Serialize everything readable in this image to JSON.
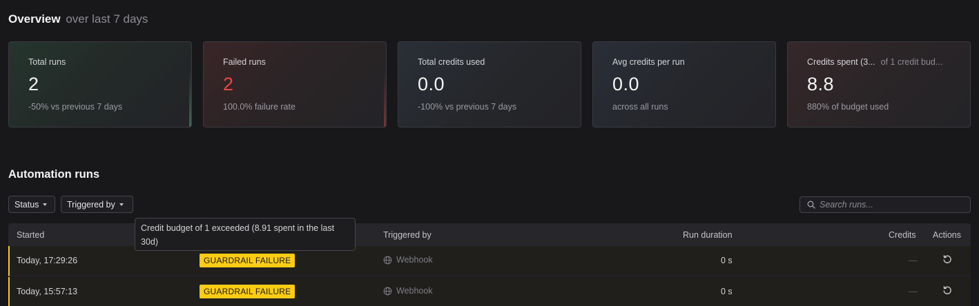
{
  "overview": {
    "title": "Overview",
    "subtitle": "over last 7 days"
  },
  "cards": [
    {
      "label": "Total runs",
      "value": "2",
      "note": "-50% vs previous 7 days"
    },
    {
      "label": "Failed runs",
      "value": "2",
      "note": "100.0% failure rate",
      "value_color": "#ef4444"
    },
    {
      "label": "Total credits used",
      "value": "0.0",
      "note": "-100% vs previous 7 days"
    },
    {
      "label": "Avg credits per run",
      "value": "0.0",
      "note": "across all runs"
    },
    {
      "label": "Credits spent (3...",
      "label_extra": "of 1 credit bud...",
      "value": "8.8",
      "note": "880% of budget used"
    }
  ],
  "runs": {
    "title": "Automation runs",
    "filters": {
      "status": "Status",
      "triggered_by": "Triggered by"
    },
    "search": {
      "placeholder": "Search runs...",
      "icon": "search-icon"
    },
    "columns": {
      "started": "Started",
      "triggered_by": "Triggered by",
      "run_duration": "Run duration",
      "credits": "Credits",
      "actions": "Actions"
    },
    "rows": [
      {
        "started": "Today, 17:29:26",
        "status": "GUARDRAIL FAILURE",
        "triggered_by": "Webhook",
        "duration": "0 s",
        "credits": "—",
        "action_icon": "retry-icon"
      },
      {
        "started": "Today, 15:57:13",
        "status": "GUARDRAIL FAILURE",
        "triggered_by": "Webhook",
        "duration": "0 s",
        "credits": "—",
        "action_icon": "retry-icon"
      }
    ],
    "tooltip": "Credit budget of 1 exceeded (8.91 spent in the last 30d)"
  },
  "colors": {
    "background": "#18181b",
    "failure_badge": "#facc15",
    "danger": "#ef4444"
  }
}
